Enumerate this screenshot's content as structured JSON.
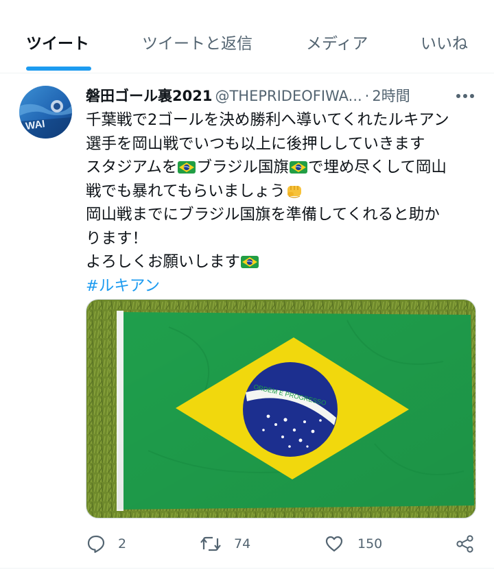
{
  "tabs": [
    {
      "label": "ツイート",
      "active": true
    },
    {
      "label": "ツイートと返信",
      "active": false
    },
    {
      "label": "メディア",
      "active": false
    },
    {
      "label": "いいね",
      "active": false
    }
  ],
  "tweet": {
    "display_name": "磐田ゴール裏2021",
    "handle": "@THEPRIDEOFIWA...",
    "separator": "·",
    "time": "2時間",
    "lines": {
      "l1": "千葉戦で2ゴールを決め勝利へ導いてくれたルキアン",
      "l2": "選手を岡山戦でいつも以上に後押ししていきます",
      "l3a": "スタジアムを",
      "l3b": "ブラジル国旗",
      "l3c": "で埋め尽くして岡山",
      "l4": "戦でも暴れてもらいましょう",
      "l5": "岡山戦までにブラジル国旗を準備してくれると助か",
      "l6": "ります！",
      "l7": "よろしくお願いします"
    },
    "hashtag": "#ルキアン",
    "flag_motto": "ORDEM E PROGRESSO",
    "avatar_text": "WAI",
    "emoji": {
      "flag": "brazil-flag",
      "fist": "oncoming-fist"
    },
    "actions": {
      "reply_count": "2",
      "retweet_count": "74",
      "like_count": "150"
    }
  },
  "colors": {
    "accent": "#1d9bf0",
    "text_primary": "#0f1419",
    "text_secondary": "#536471",
    "flag_green": "#1e9e4a",
    "flag_yellow": "#f5d90a",
    "flag_blue": "#1c2f8f"
  },
  "icons": [
    "more-icon",
    "reply-icon",
    "retweet-icon",
    "like-icon",
    "share-icon"
  ]
}
